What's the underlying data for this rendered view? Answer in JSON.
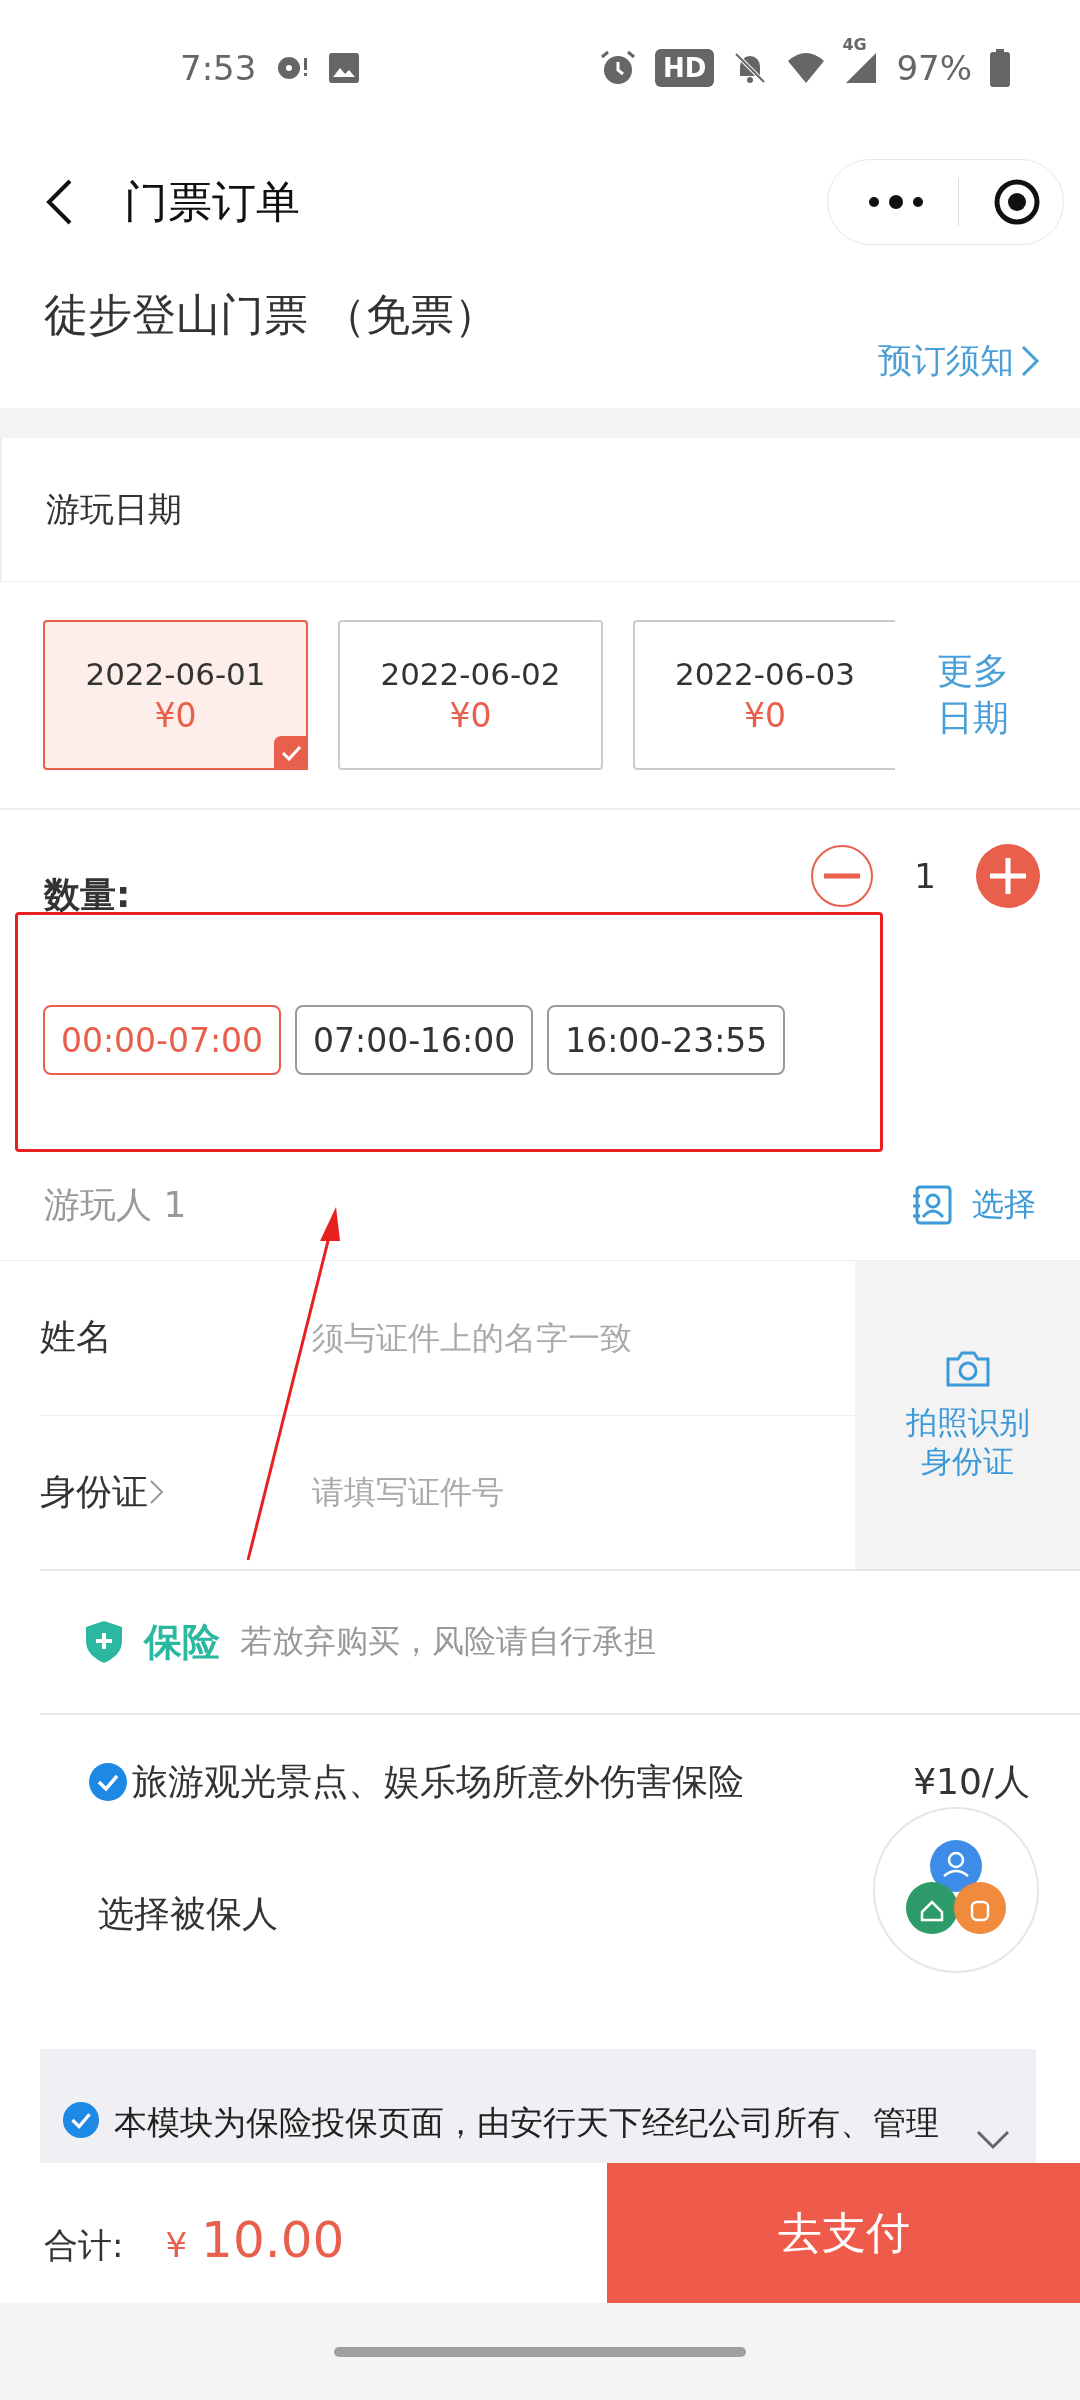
{
  "status_bar": {
    "time": "7:53",
    "hd": "HD",
    "network": "4G",
    "battery": "97%"
  },
  "header": {
    "title": "门票订单"
  },
  "ticket": {
    "title": "徒步登山门票 （免票）",
    "notice_link": "预订须知"
  },
  "date_section": {
    "label": "游玩日期",
    "more": "更多日期",
    "dates": [
      {
        "date": "2022-06-01",
        "price": "¥0",
        "selected": true
      },
      {
        "date": "2022-06-02",
        "price": "¥0",
        "selected": false
      },
      {
        "date": "2022-06-03",
        "price": "¥0",
        "selected": false
      }
    ]
  },
  "quantity": {
    "label": "数量:",
    "value": "1"
  },
  "time_slots": [
    {
      "label": "00:00-07:00",
      "selected": true
    },
    {
      "label": "07:00-16:00",
      "selected": false
    },
    {
      "label": "16:00-23:55",
      "selected": false
    }
  ],
  "visitor": {
    "title": "游玩人 1",
    "choose": "选择",
    "ocr_button": "拍照识别身份证",
    "fields": [
      {
        "label": "姓名",
        "placeholder": "须与证件上的名字一致",
        "kind": "text"
      },
      {
        "label": "身份证",
        "placeholder": "请填写证件号",
        "kind": "select"
      }
    ]
  },
  "insurance": {
    "title": "保险",
    "note": "若放弃购买，风险请自行承担",
    "plan": {
      "name": "旅游观光景点、娱乐场所意外伤害保险",
      "price": "¥10/人",
      "checked": true
    },
    "insured_label": "选择被保人"
  },
  "agreement": {
    "text": "本模块为保险投保页面，由安行天下经纪公司所有、管理",
    "checked": true
  },
  "footer": {
    "total_label": "合计:",
    "currency": "¥",
    "amount": "10.00",
    "pay_button": "去支付"
  }
}
